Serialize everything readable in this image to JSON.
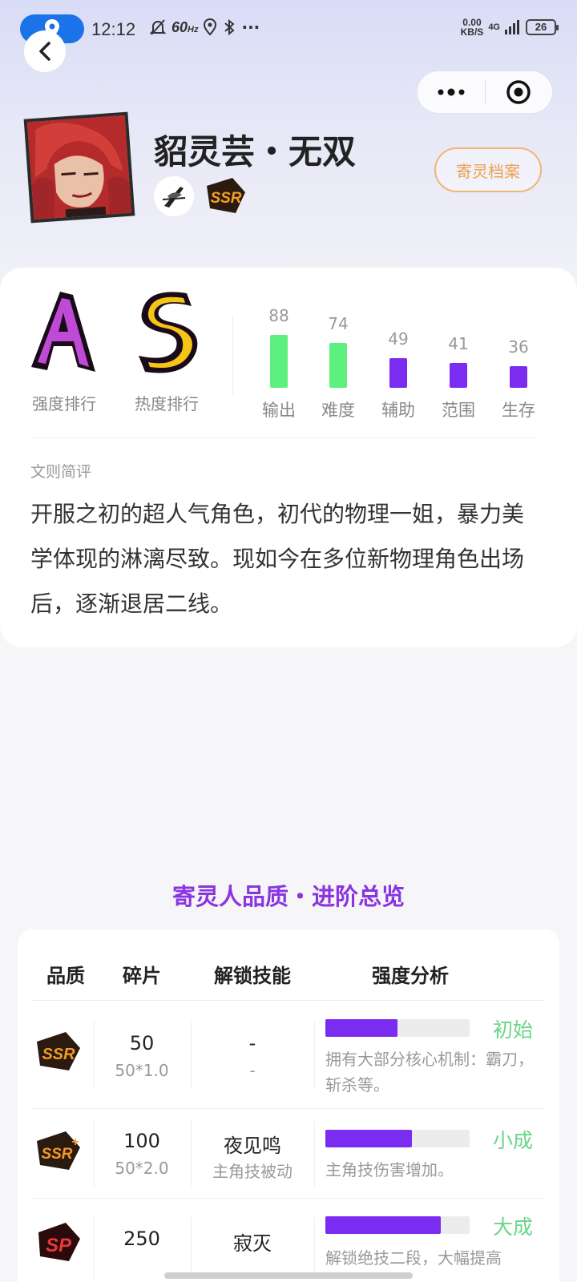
{
  "status_bar": {
    "time": "12:12",
    "refresh": "60",
    "refresh_unit": "Hz",
    "more": "···",
    "speed_value": "0.00",
    "speed_unit": "KB/S",
    "network": "4G",
    "battery": "26"
  },
  "character": {
    "name": "貂灵芸・无双",
    "archive_button": "寄灵档案"
  },
  "ranks": [
    {
      "grade": "A",
      "label": "强度排行"
    },
    {
      "grade": "S",
      "label": "热度排行"
    }
  ],
  "stats": [
    {
      "label": "输出",
      "value": 88,
      "color": "#5ef07e"
    },
    {
      "label": "难度",
      "value": 74,
      "color": "#5ef07e"
    },
    {
      "label": "辅助",
      "value": 49,
      "color": "#7a2cf0"
    },
    {
      "label": "范围",
      "value": 41,
      "color": "#7a2cf0"
    },
    {
      "label": "生存",
      "value": 36,
      "color": "#7a2cf0"
    }
  ],
  "review": {
    "title": "文则简评",
    "text": "开服之初的超人气角色，初代的物理一姐，暴力美学体现的淋漓尽致。现如今在多位新物理角色出场后，逐渐退居二线。"
  },
  "overview": {
    "title": "寄灵人品质・进阶总览",
    "headers": [
      "品质",
      "碎片",
      "解锁技能",
      "强度分析"
    ],
    "rows": [
      {
        "quality": "SSR",
        "shards": "50",
        "shards_formula": "50*1.0",
        "skill": "-",
        "skill_type": "-",
        "progress": 0.5,
        "tier": "初始",
        "analysis": "拥有大部分核心机制：霸刀，斩杀等。"
      },
      {
        "quality": "SSR+",
        "shards": "100",
        "shards_formula": "50*2.0",
        "skill": "夜见鸣",
        "skill_type": "主角技被动",
        "progress": 0.6,
        "tier": "小成",
        "analysis": "主角技伤害增加。"
      },
      {
        "quality": "SP",
        "shards": "250",
        "shards_formula": "",
        "skill": "寂灭",
        "skill_type": "",
        "progress": 0.8,
        "tier": "大成",
        "analysis": "解锁绝技二段，大幅提高"
      }
    ]
  },
  "colors": {
    "accent_purple": "#8a35e0",
    "bar_purple": "#7a2cf0",
    "bar_green": "#5ef07e",
    "archive_orange": "#f0a050",
    "tier_green": "#6ad58a"
  }
}
